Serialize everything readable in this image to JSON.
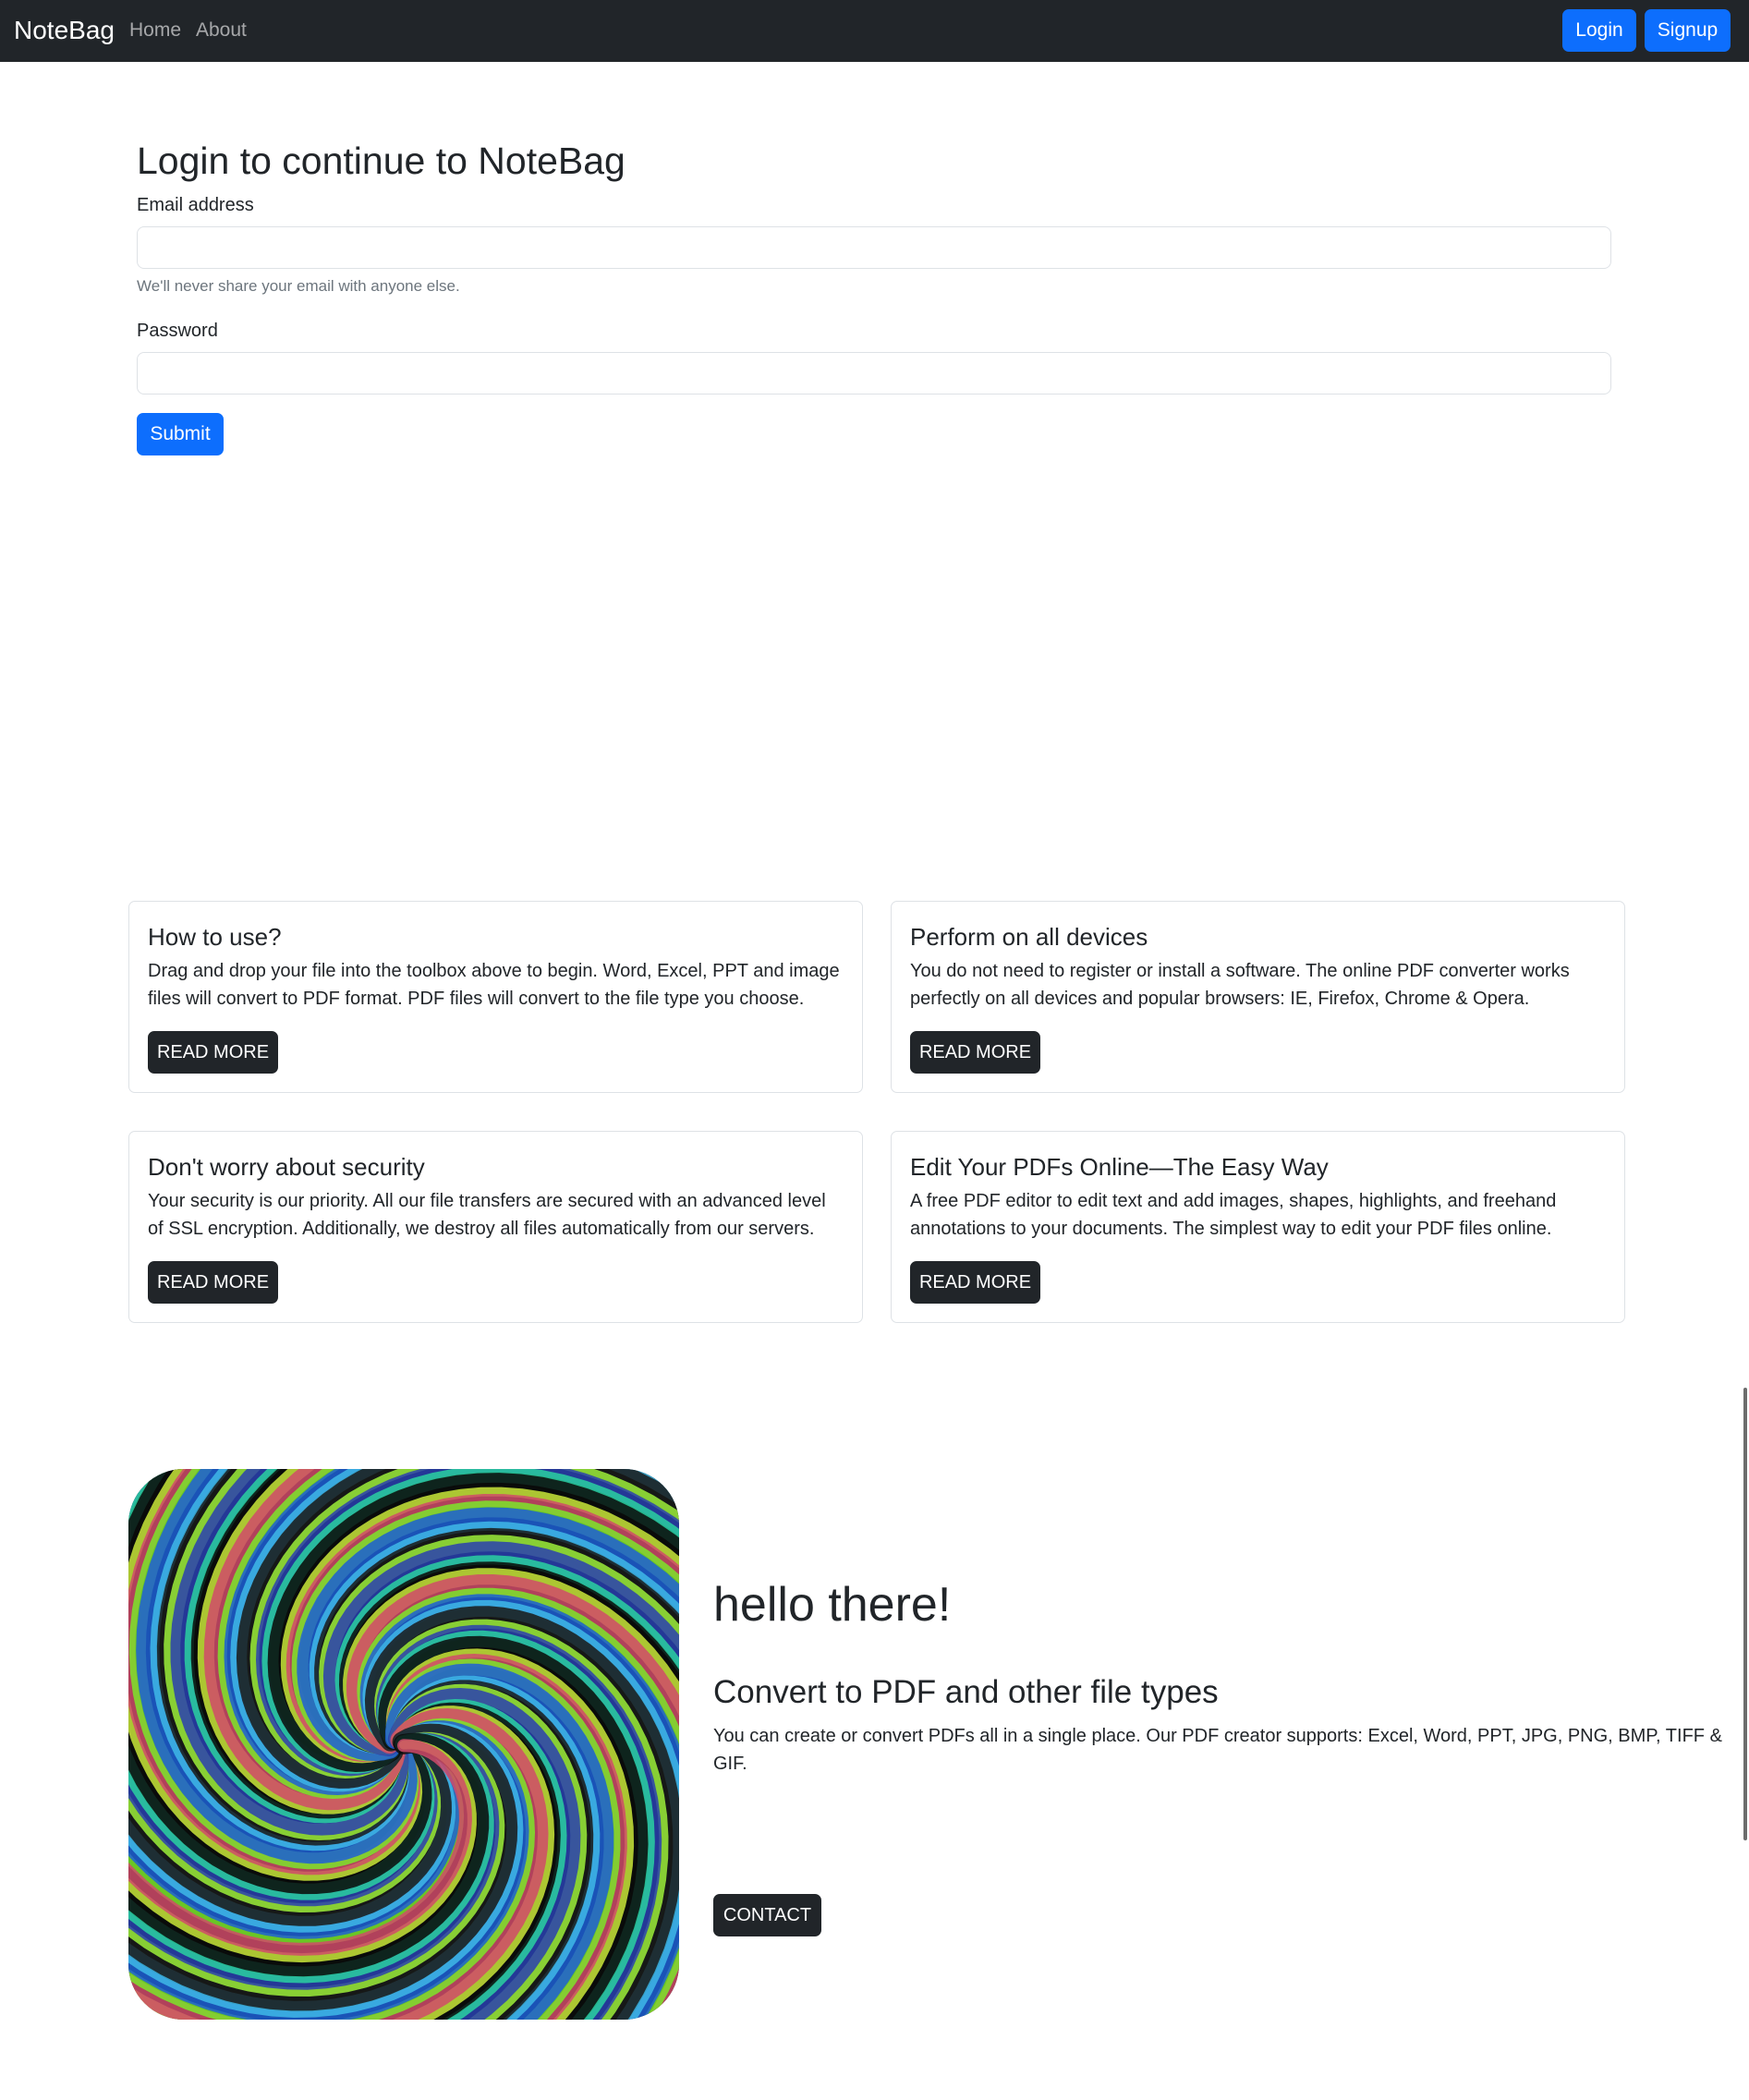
{
  "navbar": {
    "brand": "NoteBag",
    "links": [
      "Home",
      "About"
    ],
    "login_label": "Login",
    "signup_label": "Signup"
  },
  "login": {
    "title": "Login to continue to NoteBag",
    "email_label": "Email address",
    "email_value": "",
    "email_help": "We'll never share your email with anyone else.",
    "password_label": "Password",
    "password_value": "",
    "submit_label": "Submit"
  },
  "cards": [
    {
      "title": "How to use?",
      "text": "Drag and drop your file into the toolbox above to begin. Word, Excel, PPT and image files will convert to PDF format. PDF files will convert to the file type you choose.",
      "button": "READ MORE"
    },
    {
      "title": "Perform on all devices",
      "text": "You do not need to register or install a software. The online PDF converter works perfectly on all devices and popular browsers: IE, Firefox, Chrome & Opera.",
      "button": "READ MORE"
    },
    {
      "title": "Don't worry about security",
      "text": "Your security is our priority. All our file transfers are secured with an advanced level of SSL encryption. Additionally, we destroy all files automatically from our servers.",
      "button": "READ MORE"
    },
    {
      "title": "Edit Your PDFs Online—The Easy Way",
      "text": "A free PDF editor to edit text and add images, shapes, highlights, and freehand annotations to your documents. The simplest way to edit your PDF files online.",
      "button": "READ MORE"
    }
  ],
  "hero": {
    "heading": "hello there!",
    "subheading": "Convert to PDF and other file types",
    "text": "You can create or convert PDFs all in a single place. Our PDF creator supports: Excel, Word, PPT, JPG, PNG, BMP, TIFF & GIF.",
    "contact_label": "CONTACT",
    "image_icon": "swirl-image"
  },
  "colors": {
    "navbar_bg": "#212529",
    "primary": "#0d6efd",
    "dark_button": "#212529",
    "border": "#dee2e6",
    "muted_text": "#6c757d"
  }
}
